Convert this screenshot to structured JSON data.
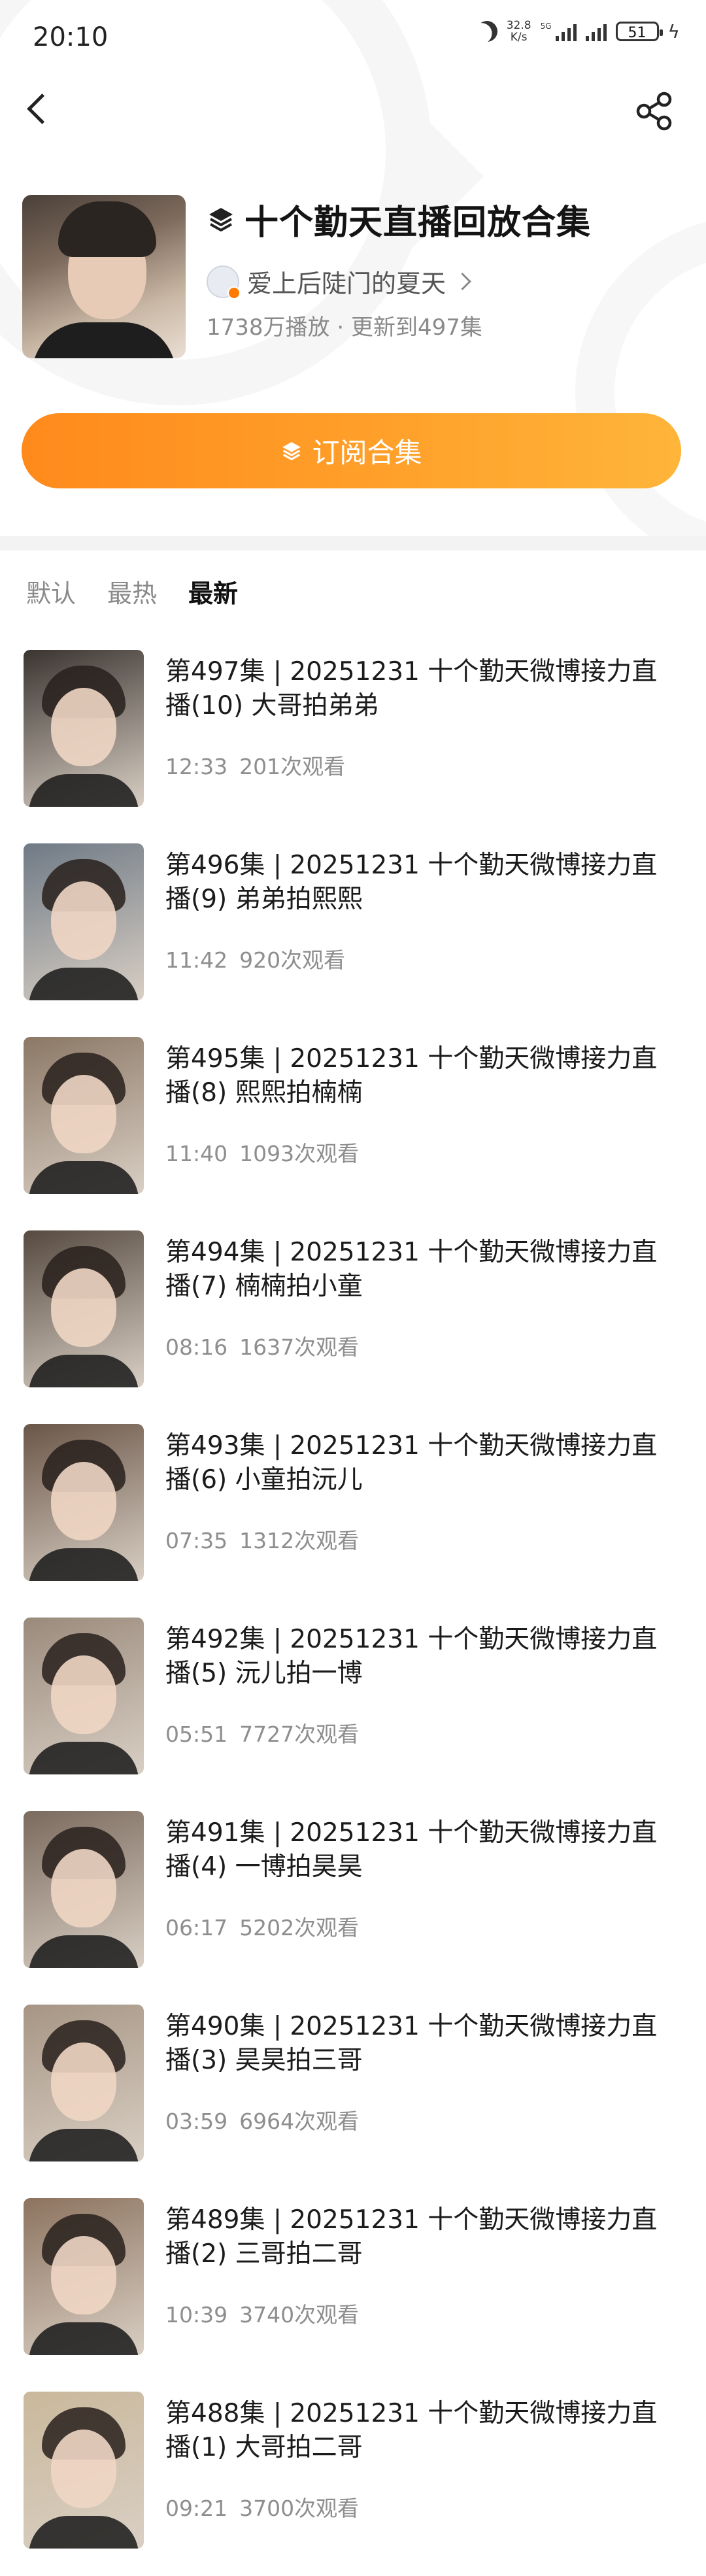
{
  "status_bar": {
    "time": "20:10",
    "net_speed_value": "32.8",
    "net_speed_unit": "K/s",
    "signal_label": "5G",
    "battery": "51"
  },
  "header": {
    "title": "十个勤天直播回放合集",
    "author": "爱上后陡门的夏天",
    "stats": "1738万播放 · 更新到497集"
  },
  "subscribe": {
    "label": "订阅合集"
  },
  "tabs": [
    {
      "label": "默认"
    },
    {
      "label": "最热"
    },
    {
      "label": "最新"
    }
  ],
  "episodes": [
    {
      "title": "第497集 | 20251231 十个勤天微博接力直播(10) 大哥拍弟弟",
      "duration": "12:33",
      "views": "201次观看",
      "thumb_color": "#3a3430"
    },
    {
      "title": "第496集 | 20251231 十个勤天微博接力直播(9) 弟弟拍熙熙",
      "duration": "11:42",
      "views": "920次观看",
      "thumb_color": "#6f7a86"
    },
    {
      "title": "第495集 | 20251231 十个勤天微博接力直播(8) 熙熙拍楠楠",
      "duration": "11:40",
      "views": "1093次观看",
      "thumb_color": "#8b7866"
    },
    {
      "title": "第494集 | 20251231 十个勤天微博接力直播(7) 楠楠拍小童",
      "duration": "08:16",
      "views": "1637次观看",
      "thumb_color": "#564a40"
    },
    {
      "title": "第493集 | 20251231 十个勤天微博接力直播(6) 小童拍沅儿",
      "duration": "07:35",
      "views": "1312次观看",
      "thumb_color": "#6a5648"
    },
    {
      "title": "第492集 | 20251231 十个勤天微博接力直播(5) 沅儿拍一博",
      "duration": "05:51",
      "views": "7727次观看",
      "thumb_color": "#9a8a7c"
    },
    {
      "title": "第491集 | 20251231 十个勤天微博接力直播(4) 一博拍昊昊",
      "duration": "06:17",
      "views": "5202次观看",
      "thumb_color": "#7b6a5e"
    },
    {
      "title": "第490集 | 20251231 十个勤天微博接力直播(3) 昊昊拍三哥",
      "duration": "03:59",
      "views": "6964次观看",
      "thumb_color": "#a69584"
    },
    {
      "title": "第489集 | 20251231 十个勤天微博接力直播(2) 三哥拍二哥",
      "duration": "10:39",
      "views": "3740次观看",
      "thumb_color": "#8c735f"
    },
    {
      "title": "第488集 | 20251231 十个勤天微博接力直播(1) 大哥拍二哥",
      "duration": "09:21",
      "views": "3700次观看",
      "thumb_color": "#c9b89b"
    }
  ],
  "icons": {
    "back": "chevron-left-icon",
    "share": "share-icon",
    "collection": "layers-icon"
  },
  "colors": {
    "accent": "#ff9a24",
    "text_primary": "#1b1b1b",
    "text_secondary": "#8e8e8e"
  }
}
